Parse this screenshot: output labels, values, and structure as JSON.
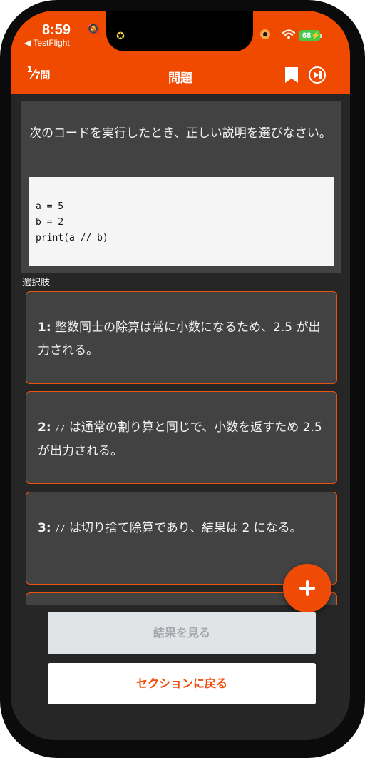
{
  "status_bar": {
    "time": "8:59",
    "back_app": "◀ TestFlight",
    "battery_level": "68"
  },
  "header": {
    "counter_current": "1",
    "counter_total": "7問",
    "title": "問題",
    "icons": [
      "bookmark-icon",
      "skip-forward-icon"
    ]
  },
  "question": {
    "text": "次のコードを実行したとき、正しい説明を選びなさい。",
    "code_lines": [
      "a = 5",
      "b = 2",
      "print(a // b)"
    ]
  },
  "choices_label": "選択肢",
  "choices": [
    {
      "num": "1:",
      "code": "",
      "text": "整数同士の除算は常に小数になるため、2.5 が出力される。"
    },
    {
      "num": "2:",
      "code": "//",
      "text": "は通常の割り算と同じで、小数を返すため 2.5 が出力される。"
    },
    {
      "num": "3:",
      "code": "//",
      "text": "は切り捨て除算であり、結果は 2 になる。"
    }
  ],
  "buttons": {
    "result": "結果を見る",
    "back": "セクションに戻る"
  },
  "colors": {
    "accent": "#ef4a00",
    "background": "#262626",
    "card": "#424242"
  }
}
